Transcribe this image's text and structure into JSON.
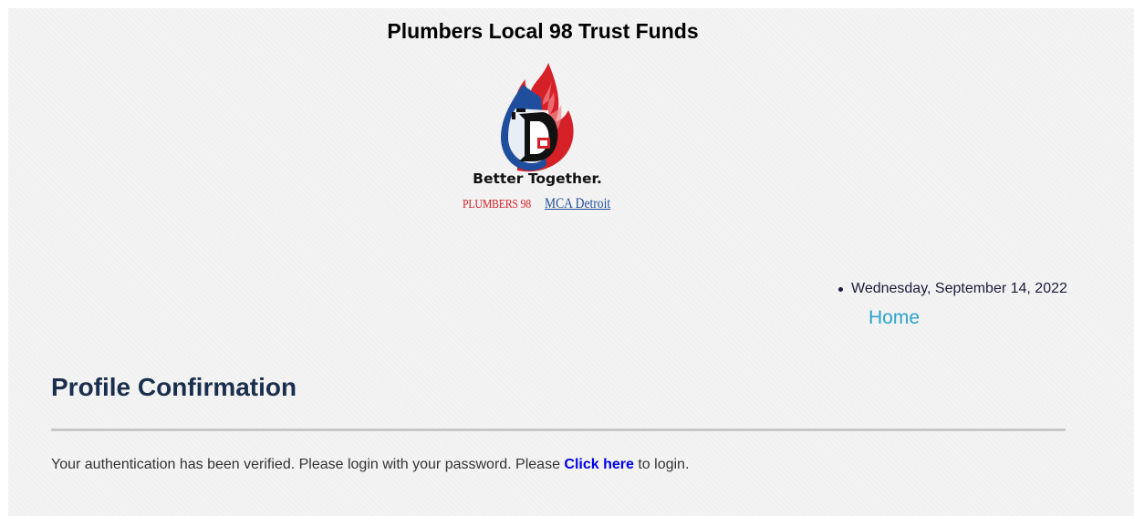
{
  "header": {
    "site_title": "Plumbers Local 98 Trust Funds"
  },
  "logo": {
    "tagline": "Better Together.",
    "org_left": "PLUMBERS 98",
    "org_right": "MCA Detroit",
    "colors": {
      "red": "#d62027",
      "blue": "#1f4e9c"
    }
  },
  "nav": {
    "date": "Wednesday, September 14, 2022",
    "home_label": "Home"
  },
  "main": {
    "heading": "Profile Confirmation",
    "message_before": "Your authentication has been verified. Please login with your password. Please ",
    "link_label": "Click here",
    "message_after": " to login."
  },
  "colors": {
    "heading": "#1a2e4d",
    "home_link": "#2ba3c9",
    "click_link": "#0000ee",
    "background": "#f1f1f1"
  }
}
